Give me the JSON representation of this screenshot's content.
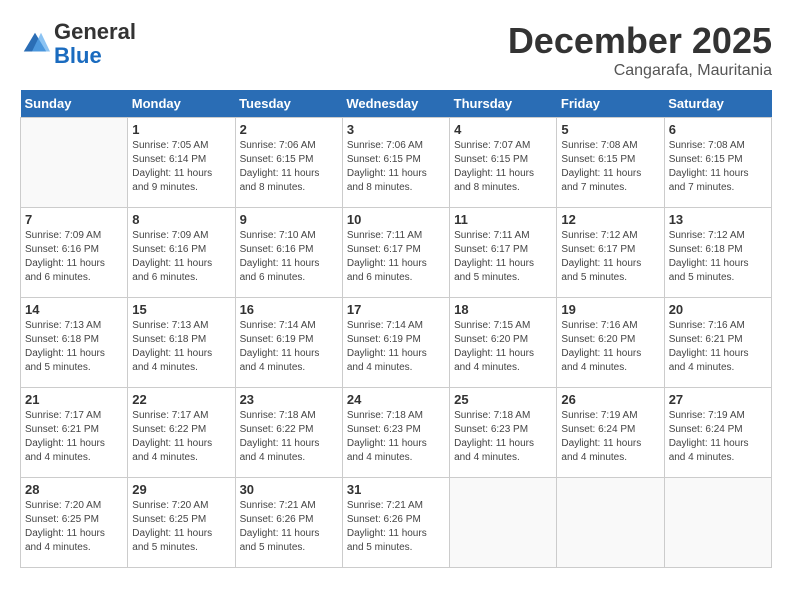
{
  "header": {
    "logo_general": "General",
    "logo_blue": "Blue",
    "month_title": "December 2025",
    "location": "Cangarafa, Mauritania"
  },
  "weekdays": [
    "Sunday",
    "Monday",
    "Tuesday",
    "Wednesday",
    "Thursday",
    "Friday",
    "Saturday"
  ],
  "weeks": [
    [
      {
        "day": "",
        "sunrise": "",
        "sunset": "",
        "daylight": ""
      },
      {
        "day": "1",
        "sunrise": "Sunrise: 7:05 AM",
        "sunset": "Sunset: 6:14 PM",
        "daylight": "Daylight: 11 hours and 9 minutes."
      },
      {
        "day": "2",
        "sunrise": "Sunrise: 7:06 AM",
        "sunset": "Sunset: 6:15 PM",
        "daylight": "Daylight: 11 hours and 8 minutes."
      },
      {
        "day": "3",
        "sunrise": "Sunrise: 7:06 AM",
        "sunset": "Sunset: 6:15 PM",
        "daylight": "Daylight: 11 hours and 8 minutes."
      },
      {
        "day": "4",
        "sunrise": "Sunrise: 7:07 AM",
        "sunset": "Sunset: 6:15 PM",
        "daylight": "Daylight: 11 hours and 8 minutes."
      },
      {
        "day": "5",
        "sunrise": "Sunrise: 7:08 AM",
        "sunset": "Sunset: 6:15 PM",
        "daylight": "Daylight: 11 hours and 7 minutes."
      },
      {
        "day": "6",
        "sunrise": "Sunrise: 7:08 AM",
        "sunset": "Sunset: 6:15 PM",
        "daylight": "Daylight: 11 hours and 7 minutes."
      }
    ],
    [
      {
        "day": "7",
        "sunrise": "Sunrise: 7:09 AM",
        "sunset": "Sunset: 6:16 PM",
        "daylight": "Daylight: 11 hours and 6 minutes."
      },
      {
        "day": "8",
        "sunrise": "Sunrise: 7:09 AM",
        "sunset": "Sunset: 6:16 PM",
        "daylight": "Daylight: 11 hours and 6 minutes."
      },
      {
        "day": "9",
        "sunrise": "Sunrise: 7:10 AM",
        "sunset": "Sunset: 6:16 PM",
        "daylight": "Daylight: 11 hours and 6 minutes."
      },
      {
        "day": "10",
        "sunrise": "Sunrise: 7:11 AM",
        "sunset": "Sunset: 6:17 PM",
        "daylight": "Daylight: 11 hours and 6 minutes."
      },
      {
        "day": "11",
        "sunrise": "Sunrise: 7:11 AM",
        "sunset": "Sunset: 6:17 PM",
        "daylight": "Daylight: 11 hours and 5 minutes."
      },
      {
        "day": "12",
        "sunrise": "Sunrise: 7:12 AM",
        "sunset": "Sunset: 6:17 PM",
        "daylight": "Daylight: 11 hours and 5 minutes."
      },
      {
        "day": "13",
        "sunrise": "Sunrise: 7:12 AM",
        "sunset": "Sunset: 6:18 PM",
        "daylight": "Daylight: 11 hours and 5 minutes."
      }
    ],
    [
      {
        "day": "14",
        "sunrise": "Sunrise: 7:13 AM",
        "sunset": "Sunset: 6:18 PM",
        "daylight": "Daylight: 11 hours and 5 minutes."
      },
      {
        "day": "15",
        "sunrise": "Sunrise: 7:13 AM",
        "sunset": "Sunset: 6:18 PM",
        "daylight": "Daylight: 11 hours and 4 minutes."
      },
      {
        "day": "16",
        "sunrise": "Sunrise: 7:14 AM",
        "sunset": "Sunset: 6:19 PM",
        "daylight": "Daylight: 11 hours and 4 minutes."
      },
      {
        "day": "17",
        "sunrise": "Sunrise: 7:14 AM",
        "sunset": "Sunset: 6:19 PM",
        "daylight": "Daylight: 11 hours and 4 minutes."
      },
      {
        "day": "18",
        "sunrise": "Sunrise: 7:15 AM",
        "sunset": "Sunset: 6:20 PM",
        "daylight": "Daylight: 11 hours and 4 minutes."
      },
      {
        "day": "19",
        "sunrise": "Sunrise: 7:16 AM",
        "sunset": "Sunset: 6:20 PM",
        "daylight": "Daylight: 11 hours and 4 minutes."
      },
      {
        "day": "20",
        "sunrise": "Sunrise: 7:16 AM",
        "sunset": "Sunset: 6:21 PM",
        "daylight": "Daylight: 11 hours and 4 minutes."
      }
    ],
    [
      {
        "day": "21",
        "sunrise": "Sunrise: 7:17 AM",
        "sunset": "Sunset: 6:21 PM",
        "daylight": "Daylight: 11 hours and 4 minutes."
      },
      {
        "day": "22",
        "sunrise": "Sunrise: 7:17 AM",
        "sunset": "Sunset: 6:22 PM",
        "daylight": "Daylight: 11 hours and 4 minutes."
      },
      {
        "day": "23",
        "sunrise": "Sunrise: 7:18 AM",
        "sunset": "Sunset: 6:22 PM",
        "daylight": "Daylight: 11 hours and 4 minutes."
      },
      {
        "day": "24",
        "sunrise": "Sunrise: 7:18 AM",
        "sunset": "Sunset: 6:23 PM",
        "daylight": "Daylight: 11 hours and 4 minutes."
      },
      {
        "day": "25",
        "sunrise": "Sunrise: 7:18 AM",
        "sunset": "Sunset: 6:23 PM",
        "daylight": "Daylight: 11 hours and 4 minutes."
      },
      {
        "day": "26",
        "sunrise": "Sunrise: 7:19 AM",
        "sunset": "Sunset: 6:24 PM",
        "daylight": "Daylight: 11 hours and 4 minutes."
      },
      {
        "day": "27",
        "sunrise": "Sunrise: 7:19 AM",
        "sunset": "Sunset: 6:24 PM",
        "daylight": "Daylight: 11 hours and 4 minutes."
      }
    ],
    [
      {
        "day": "28",
        "sunrise": "Sunrise: 7:20 AM",
        "sunset": "Sunset: 6:25 PM",
        "daylight": "Daylight: 11 hours and 4 minutes."
      },
      {
        "day": "29",
        "sunrise": "Sunrise: 7:20 AM",
        "sunset": "Sunset: 6:25 PM",
        "daylight": "Daylight: 11 hours and 5 minutes."
      },
      {
        "day": "30",
        "sunrise": "Sunrise: 7:21 AM",
        "sunset": "Sunset: 6:26 PM",
        "daylight": "Daylight: 11 hours and 5 minutes."
      },
      {
        "day": "31",
        "sunrise": "Sunrise: 7:21 AM",
        "sunset": "Sunset: 6:26 PM",
        "daylight": "Daylight: 11 hours and 5 minutes."
      },
      {
        "day": "",
        "sunrise": "",
        "sunset": "",
        "daylight": ""
      },
      {
        "day": "",
        "sunrise": "",
        "sunset": "",
        "daylight": ""
      },
      {
        "day": "",
        "sunrise": "",
        "sunset": "",
        "daylight": ""
      }
    ]
  ]
}
